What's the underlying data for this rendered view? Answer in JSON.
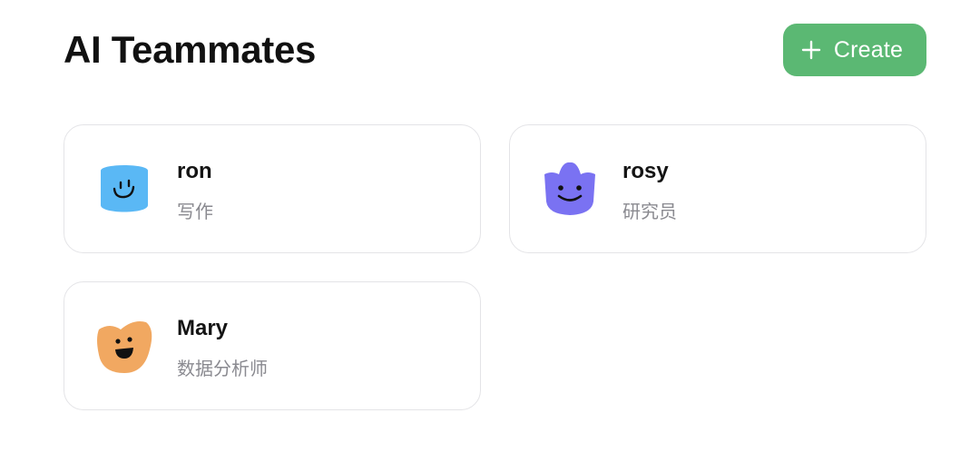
{
  "header": {
    "title": "AI Teammates",
    "create_label": "Create",
    "create_icon": "plus-icon"
  },
  "teammates": [
    {
      "name": "ron",
      "role": "写作",
      "avatar_icon": "blue-smiley-avatar",
      "avatar_color": "#5ab8f5"
    },
    {
      "name": "rosy",
      "role": "研究员",
      "avatar_icon": "purple-smiley-avatar",
      "avatar_color": "#7a72f2"
    },
    {
      "name": "Mary",
      "role": "数据分析师",
      "avatar_icon": "orange-smiley-avatar",
      "avatar_color": "#f1a861"
    }
  ],
  "colors": {
    "accent": "#5bb873",
    "card_border": "#e4e4e7",
    "muted_text": "#8a8a90"
  }
}
